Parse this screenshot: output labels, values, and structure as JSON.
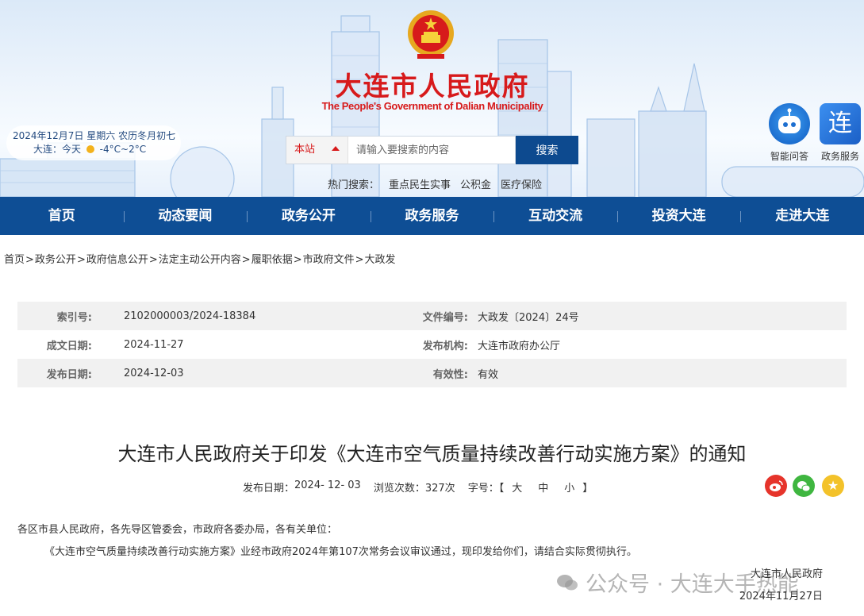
{
  "header": {
    "title_cn": "大连市人民政府",
    "title_en": "The People's Government of Dalian Municipality",
    "date_line": "2024年12月7日 星期六 农历冬月初七",
    "weather_city": "大连：今天",
    "weather_temp": "-4°C~2°C",
    "search": {
      "scope": "本站",
      "placeholder": "请输入要搜索的内容",
      "button": "搜索"
    },
    "hot_label": "热门搜索：",
    "hot_items": [
      "重点民生实事",
      "公积金",
      "医疗保险"
    ],
    "quick": {
      "ai": "智能问答",
      "gov": "政务服务",
      "gov_glyph": "连"
    }
  },
  "nav": [
    "首页",
    "动态要闻",
    "政务公开",
    "政务服务",
    "互动交流",
    "投资大连",
    "走进大连"
  ],
  "breadcrumb": [
    "首页",
    "政务公开",
    "政府信息公开",
    "法定主动公开内容",
    "履职依据",
    "市政府文件",
    "大政发"
  ],
  "meta": {
    "rows": [
      {
        "k1": "索引号:",
        "v1": "2102000003/2024-18384",
        "k2": "文件编号:",
        "v2": "大政发〔2024〕24号"
      },
      {
        "k1": "成文日期:",
        "v1": "2024-11-27",
        "k2": "发布机构:",
        "v2": "大连市政府办公厅"
      },
      {
        "k1": "发布日期:",
        "v1": "2024-12-03",
        "k2": "有效性:",
        "v2": "有效"
      }
    ]
  },
  "article": {
    "title": "大连市人民政府关于印发《大连市空气质量持续改善行动实施方案》的通知",
    "pub_label": "发布日期：",
    "pub_date": "2024- 12- 03",
    "views_label": "浏览次数：",
    "views": "327次",
    "font_label": "字号：【",
    "font_large": "大",
    "font_medium": "中",
    "font_small": "小",
    "font_close": "】",
    "para1": "各区市县人民政府，各先导区管委会，市政府各委办局，各有关单位：",
    "para2": "《大连市空气质量持续改善行动实施方案》业经市政府2024年第107次常务会议审议通过，现印发给你们，请结合实际贯彻执行。",
    "signature": "大连市人民政府",
    "sign_date": "2024年11月27日"
  },
  "watermark": "公众号 · 大连大手热能",
  "colors": {
    "nav": "#0e4e95",
    "brand_red": "#d71a1b",
    "search_btn": "#0d4a8f"
  }
}
